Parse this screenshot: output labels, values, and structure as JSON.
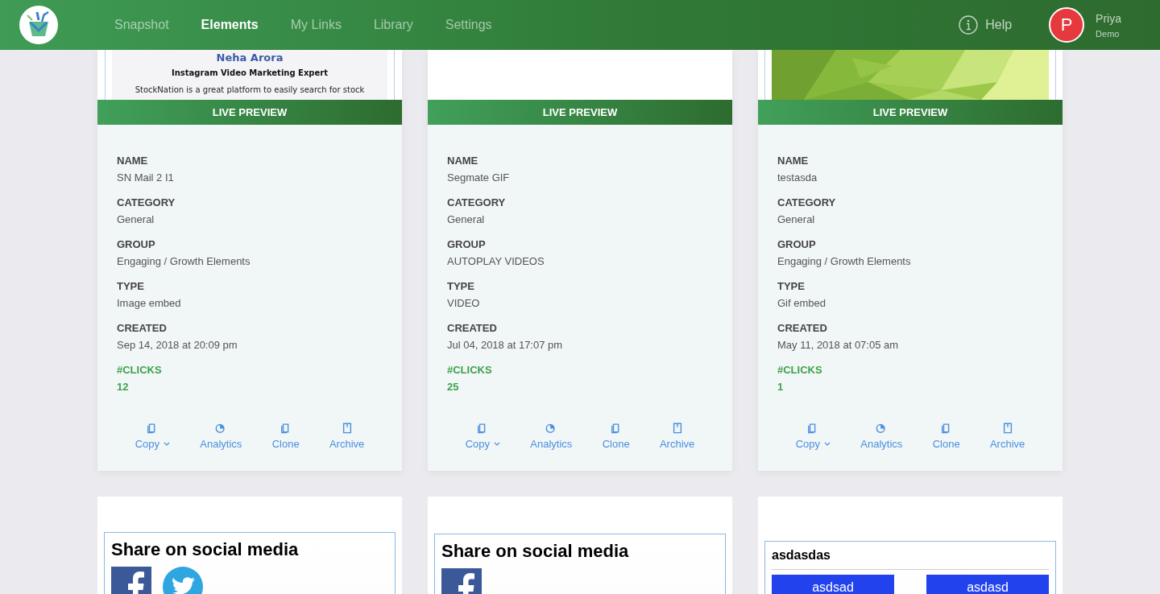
{
  "header": {
    "nav": [
      {
        "label": "Snapshot",
        "selected": false
      },
      {
        "label": "Elements",
        "selected": true
      },
      {
        "label": "My Links",
        "selected": false
      },
      {
        "label": "Library",
        "selected": false
      },
      {
        "label": "Settings",
        "selected": false
      }
    ],
    "help": "Help",
    "user": {
      "initial": "P",
      "name": "Priya",
      "role": "Demo"
    }
  },
  "cards": [
    {
      "preview": {
        "kind": "profile",
        "name": "Neha Arora",
        "title": "Instagram Video Marketing Expert",
        "text": "StockNation is a great platform to easily search for stock"
      },
      "preview_label": "LIVE PREVIEW",
      "fields": [
        {
          "label": "NAME",
          "value": "SN Mail 2 I1"
        },
        {
          "label": "CATEGORY",
          "value": "General"
        },
        {
          "label": "GROUP",
          "value": "Engaging / Growth Elements"
        },
        {
          "label": "TYPE",
          "value": "Image embed"
        },
        {
          "label": "CREATED",
          "value": "Sep 14, 2018 at 20:09 pm"
        }
      ],
      "clicks": {
        "label": "#CLICKS",
        "value": "12"
      },
      "actions": [
        {
          "kind": "copy",
          "label": "Copy",
          "dropdown": true
        },
        {
          "kind": "analytics",
          "label": "Analytics",
          "dropdown": false
        },
        {
          "kind": "clone",
          "label": "Clone",
          "dropdown": false
        },
        {
          "kind": "archive",
          "label": "Archive",
          "dropdown": false
        }
      ]
    },
    {
      "preview": {
        "kind": "blank"
      },
      "preview_label": "LIVE PREVIEW",
      "fields": [
        {
          "label": "NAME",
          "value": "Segmate GIF"
        },
        {
          "label": "CATEGORY",
          "value": "General"
        },
        {
          "label": "GROUP",
          "value": "AUTOPLAY VIDEOS"
        },
        {
          "label": "TYPE",
          "value": "VIDEO"
        },
        {
          "label": "CREATED",
          "value": "Jul 04, 2018 at 17:07 pm"
        }
      ],
      "clicks": {
        "label": "#CLICKS",
        "value": "25"
      },
      "actions": [
        {
          "kind": "copy",
          "label": "Copy",
          "dropdown": true
        },
        {
          "kind": "analytics",
          "label": "Analytics",
          "dropdown": false
        },
        {
          "kind": "clone",
          "label": "Clone",
          "dropdown": false
        },
        {
          "kind": "archive",
          "label": "Archive",
          "dropdown": false
        }
      ]
    },
    {
      "preview": {
        "kind": "picture"
      },
      "preview_label": "LIVE PREVIEW",
      "fields": [
        {
          "label": "NAME",
          "value": "testasda"
        },
        {
          "label": "CATEGORY",
          "value": "General"
        },
        {
          "label": "GROUP",
          "value": "Engaging / Growth Elements"
        },
        {
          "label": "TYPE",
          "value": "Gif embed"
        },
        {
          "label": "CREATED",
          "value": "May 11, 2018 at 07:05 am"
        }
      ],
      "clicks": {
        "label": "#CLICKS",
        "value": "1"
      },
      "actions": [
        {
          "kind": "copy",
          "label": "Copy",
          "dropdown": true
        },
        {
          "kind": "analytics",
          "label": "Analytics",
          "dropdown": false
        },
        {
          "kind": "clone",
          "label": "Clone",
          "dropdown": false
        },
        {
          "kind": "archive",
          "label": "Archive",
          "dropdown": false
        }
      ]
    }
  ],
  "widgets": [
    {
      "kind": "share",
      "title": "Share on social media",
      "icons": [
        {
          "kind": "facebook"
        },
        {
          "kind": "twitter"
        }
      ]
    },
    {
      "kind": "share",
      "title": "Share on social media",
      "icons": [
        {
          "kind": "facebook"
        }
      ]
    },
    {
      "kind": "buttons",
      "title": "asdasdas",
      "buttons": [
        "asdsad",
        "asdasd"
      ]
    }
  ]
}
